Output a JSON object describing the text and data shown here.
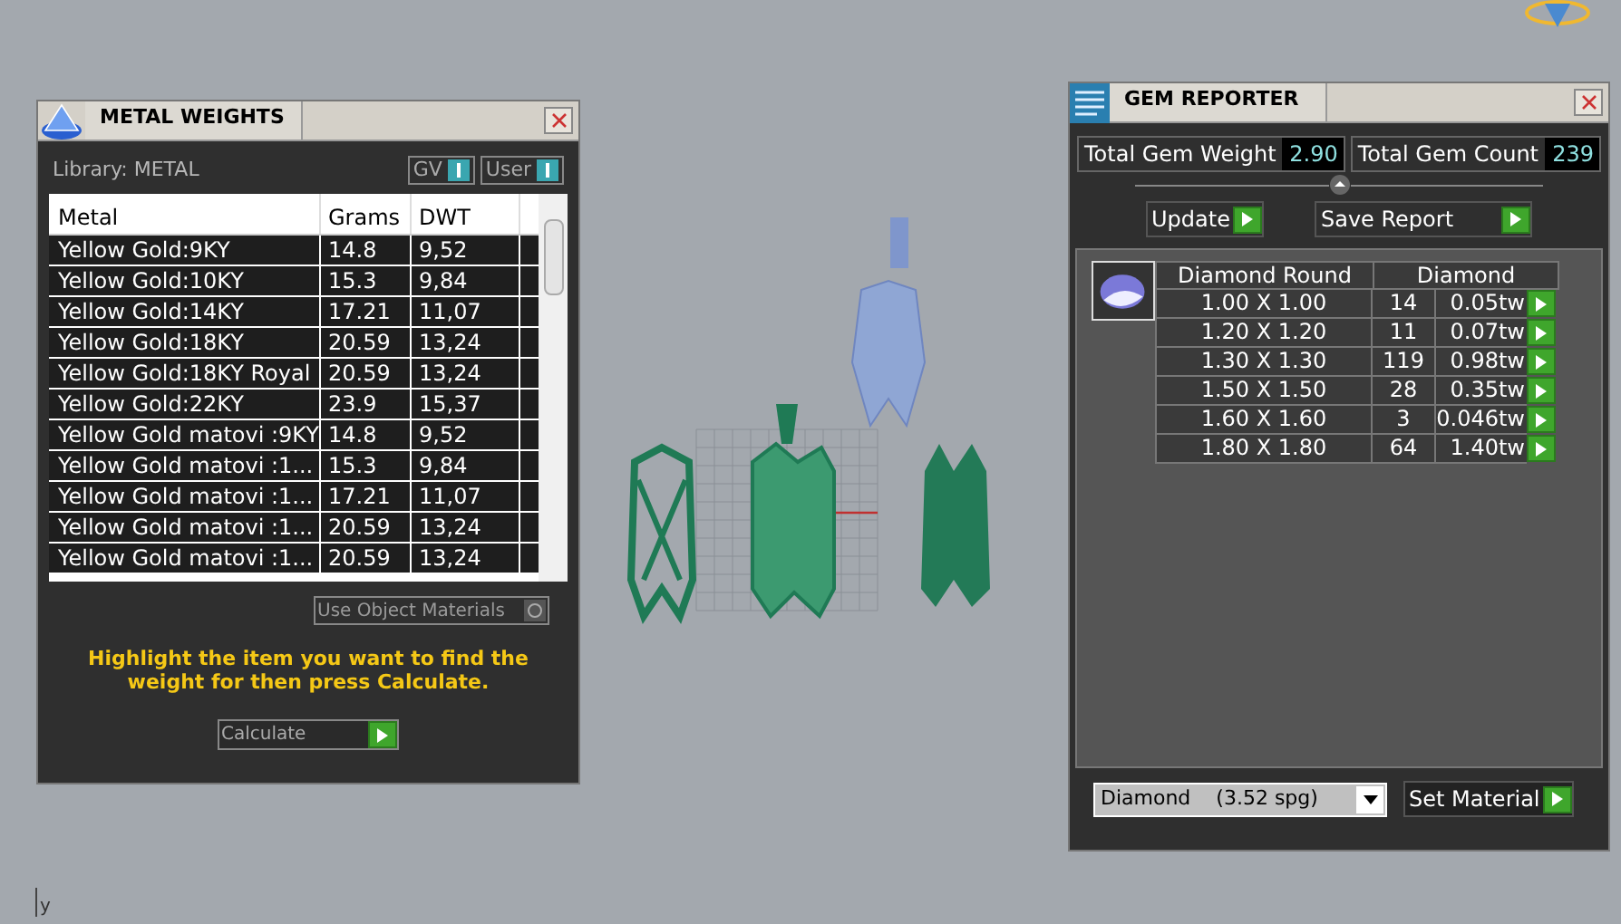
{
  "metal_weights": {
    "title": "METAL WEIGHTS",
    "library": "Library: METAL",
    "toggles": [
      {
        "label": "GV",
        "on": true
      },
      {
        "label": "User",
        "on": true
      }
    ],
    "columns": [
      "Metal",
      "Grams",
      "DWT"
    ],
    "rows": [
      {
        "metal": "Yellow Gold:9KY",
        "grams": "14.8",
        "dwt": "9,52"
      },
      {
        "metal": "Yellow Gold:10KY",
        "grams": "15.3",
        "dwt": "9,84"
      },
      {
        "metal": "Yellow Gold:14KY",
        "grams": "17.21",
        "dwt": "11,07"
      },
      {
        "metal": "Yellow Gold:18KY",
        "grams": "20.59",
        "dwt": "13,24"
      },
      {
        "metal": "Yellow Gold:18KY Royal",
        "grams": "20.59",
        "dwt": "13,24"
      },
      {
        "metal": "Yellow Gold:22KY",
        "grams": "23.9",
        "dwt": "15,37"
      },
      {
        "metal": "Yellow Gold matovi :9KY",
        "grams": "14.8",
        "dwt": "9,52"
      },
      {
        "metal": "Yellow Gold matovi :1...",
        "grams": "15.3",
        "dwt": "9,84"
      },
      {
        "metal": "Yellow Gold matovi :1...",
        "grams": "17.21",
        "dwt": "11,07"
      },
      {
        "metal": "Yellow Gold matovi :1...",
        "grams": "20.59",
        "dwt": "13,24"
      },
      {
        "metal": "Yellow Gold matovi :1...",
        "grams": "20.59",
        "dwt": "13,24"
      }
    ],
    "use_object_materials": {
      "label": "Use Object Materials",
      "checked": false
    },
    "hint": "Highlight the item you want to find the weight for then press Calculate.",
    "calculate": "Calculate"
  },
  "gem_reporter": {
    "title": "GEM REPORTER",
    "total_weight_label": "Total Gem Weight",
    "total_weight": "2.90",
    "total_count_label": "Total Gem Count",
    "total_count": "239",
    "buttons": [
      "Update",
      "Save Report"
    ],
    "columns": [
      "Diamond Round",
      "Diamond"
    ],
    "rows": [
      {
        "size": "1.00 X 1.00",
        "count": "14",
        "weight": "0.05tw"
      },
      {
        "size": "1.20 X 1.20",
        "count": "11",
        "weight": "0.07tw"
      },
      {
        "size": "1.30 X 1.30",
        "count": "119",
        "weight": "0.98tw"
      },
      {
        "size": "1.50 X 1.50",
        "count": "28",
        "weight": "0.35tw"
      },
      {
        "size": "1.60 X 1.60",
        "count": "3",
        "weight": "0.046tw"
      },
      {
        "size": "1.80 X 1.80",
        "count": "64",
        "weight": "1.40tw"
      }
    ],
    "material": "Diamond",
    "material_density": "(3.52 spg)",
    "set_material": "Set Material"
  },
  "viewport": {
    "axis_label": "y"
  }
}
